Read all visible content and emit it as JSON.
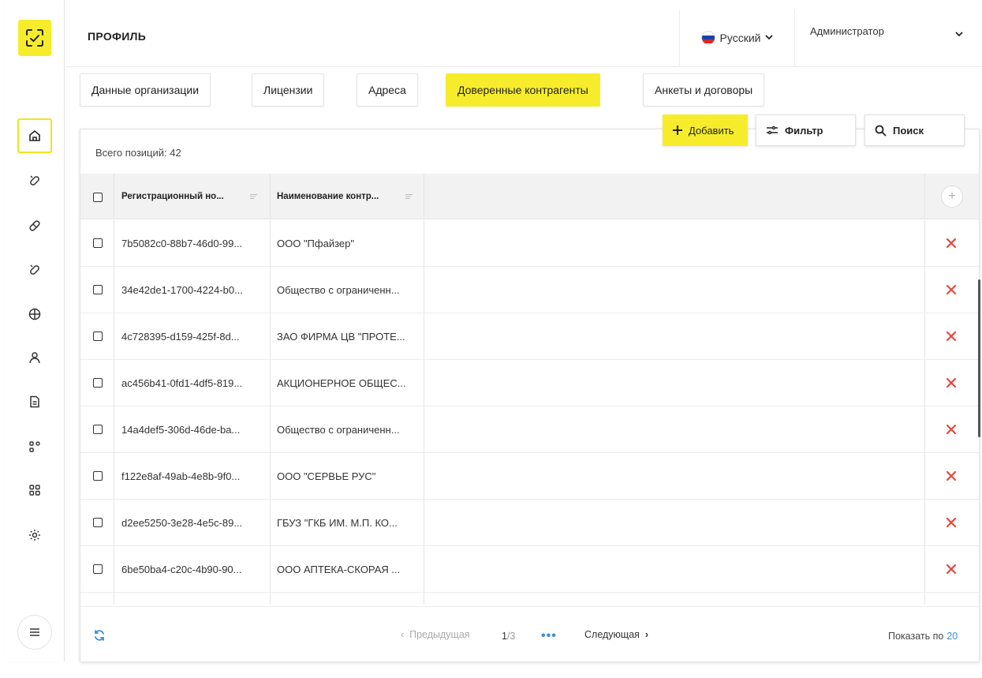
{
  "header": {
    "title": "ПРОФИЛЬ",
    "language": "Русский",
    "user": "Администратор"
  },
  "tabs": [
    {
      "label": "Данные организации",
      "active": false
    },
    {
      "label": "Лицензии",
      "active": false
    },
    {
      "label": "Адреса",
      "active": false
    },
    {
      "label": "Доверенные контрагенты",
      "active": true
    },
    {
      "label": "Анкеты и договоры",
      "active": false
    }
  ],
  "toolbar": {
    "add_label": "Добавить",
    "filter_label": "Фильтр",
    "search_label": "Поиск"
  },
  "table": {
    "total": "Всего позиций: 42",
    "columns": [
      "Регистрационный но...",
      "Наименование контр..."
    ],
    "rows": [
      [
        "7b5082c0-88b7-46d0-99...",
        "ООО \"Пфайзер\""
      ],
      [
        "34e42de1-1700-4224-b0...",
        "Общество с ограниченн..."
      ],
      [
        "4c728395-d159-425f-8d...",
        "ЗАО ФИРМА ЦВ \"ПРОТЕ..."
      ],
      [
        "ac456b41-0fd1-4df5-819...",
        "АКЦИОНЕРНОЕ ОБЩЕС..."
      ],
      [
        "14a4def5-306d-46de-ba...",
        "Общество с ограниченн..."
      ],
      [
        "f122e8af-49ab-4e8b-9f0...",
        "ООО \"СЕРВЬЕ РУС\""
      ],
      [
        "d2ee5250-3e28-4e5c-89...",
        "ГБУЗ \"ГКБ ИМ. М.П. КО..."
      ],
      [
        "6be50ba4-c20c-4b90-90...",
        "ООО АПТЕКА-СКОРАЯ ..."
      ]
    ]
  },
  "pager": {
    "prev_label": "Предыдущая",
    "next_label": "Следующая",
    "current": "1",
    "total": "/3",
    "dots": "•••",
    "show_by_label": "Показать по",
    "show_by_value": "20"
  },
  "colors": {
    "accent": "#f7ec2b",
    "delete": "#e5483f",
    "link": "#3a8fd6"
  },
  "icons": {
    "logo": "scan-logo-icon",
    "sidebar": [
      "home-icon",
      "pill-icon",
      "capsule-icon",
      "pill-icon",
      "globe-icon",
      "user-icon",
      "document-icon",
      "apps-icon",
      "grid-icon",
      "settings-icon"
    ],
    "menu": "hamburger-icon"
  }
}
